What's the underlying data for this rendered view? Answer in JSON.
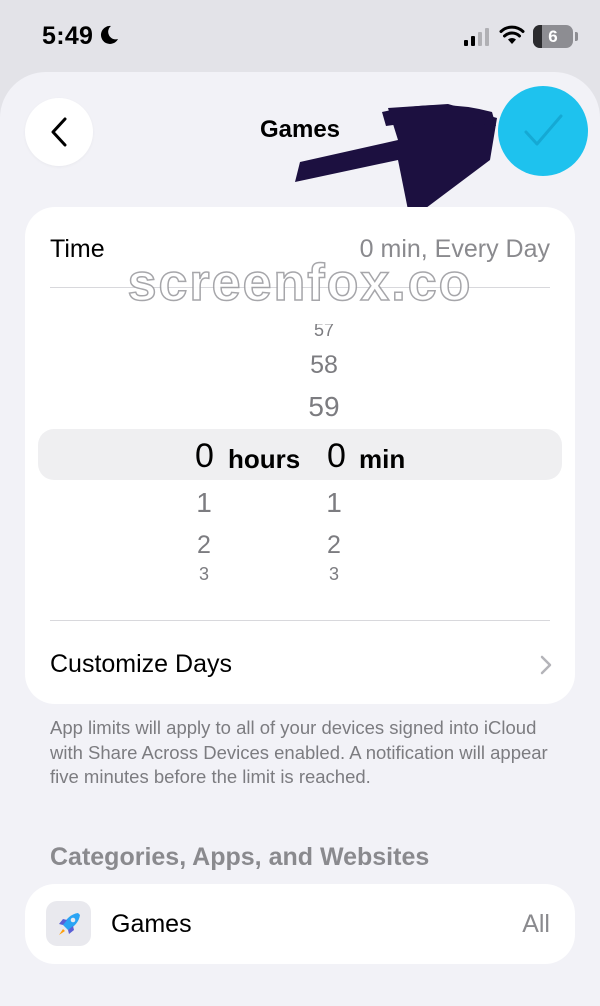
{
  "status_bar": {
    "time": "5:49",
    "battery_level": "6"
  },
  "nav": {
    "title": "Games"
  },
  "time_row": {
    "label": "Time",
    "value": "0 min, Every Day"
  },
  "watermark": "screenfox.co",
  "picker": {
    "hours": {
      "above": [],
      "selected": "0",
      "label": "hours",
      "below": [
        "1",
        "2",
        "3"
      ]
    },
    "minutes": {
      "above": [
        "57",
        "58",
        "59"
      ],
      "selected": "0",
      "label": "min",
      "below": [
        "1",
        "2",
        "3"
      ]
    }
  },
  "customize_days": {
    "label": "Customize Days"
  },
  "footer_note": "App limits will apply to all of your devices signed into iCloud with Share Across Devices enabled. A notification will appear five minutes before the limit is reached.",
  "section_header": "Categories, Apps, and Websites",
  "category_row": {
    "label": "Games",
    "value": "All",
    "icon": "rocket-icon"
  },
  "colors": {
    "accent": "#1ec2ee",
    "annotation": "#1c1040",
    "background": "#f2f2f7"
  }
}
